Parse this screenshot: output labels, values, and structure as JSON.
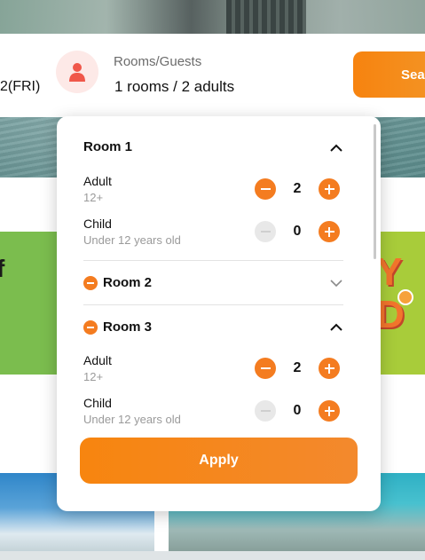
{
  "search": {
    "date_fragment": "2(FRI)",
    "guests_label": "Rooms/Guests",
    "guests_value": "1 rooms / 2 adults",
    "search_button_label": "Sea"
  },
  "popup": {
    "rooms": [
      {
        "title": "Room 1",
        "expanded": true,
        "removable": false,
        "adult": {
          "label": "Adult",
          "sub": "12+",
          "count": "2",
          "minus_enabled": true
        },
        "child": {
          "label": "Child",
          "sub": "Under 12 years old",
          "count": "0",
          "minus_enabled": false
        }
      },
      {
        "title": "Room 2",
        "expanded": false,
        "removable": true
      },
      {
        "title": "Room 3",
        "expanded": true,
        "removable": true,
        "adult": {
          "label": "Adult",
          "sub": "12+",
          "count": "2",
          "minus_enabled": true
        },
        "child": {
          "label": "Child",
          "sub": "Under 12 years old",
          "count": "0",
          "minus_enabled": false
        }
      }
    ],
    "apply_label": "Apply"
  },
  "colors": {
    "accent": "#f47c20",
    "disabled": "#e8e8e8",
    "avatar_bg": "#fde9e7",
    "avatar_icon": "#f0574a"
  }
}
